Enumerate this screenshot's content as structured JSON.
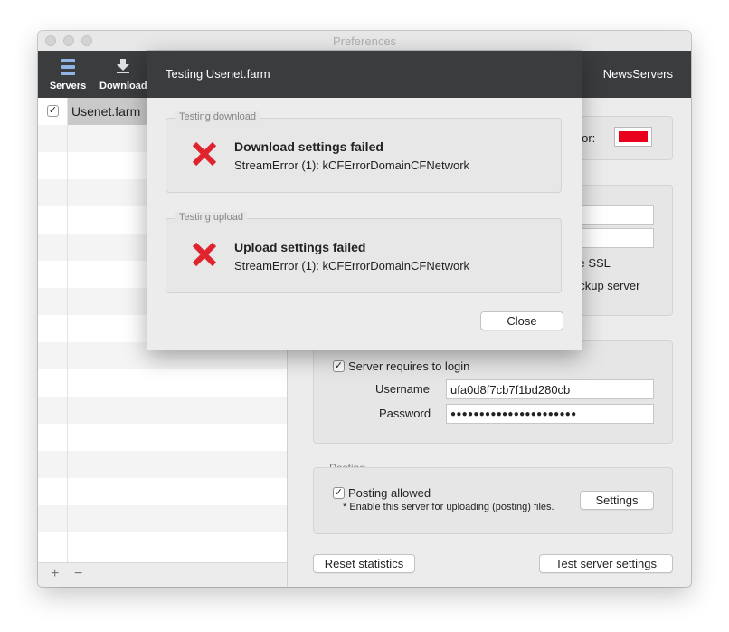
{
  "window": {
    "title": "Preferences"
  },
  "toolbar": {
    "items": [
      {
        "label": "Servers",
        "icon": "servers-icon"
      },
      {
        "label": "Download",
        "icon": "download-icon"
      }
    ],
    "right_label": "NewsServers"
  },
  "sidebar": {
    "servers": [
      {
        "name": "Usenet.farm",
        "checked": true,
        "selected": true
      }
    ],
    "add_label": "+",
    "remove_label": "−"
  },
  "main": {
    "color_label_partial": "olor:",
    "server_color": "#e8001c",
    "ssl_label_partial": "se SSL",
    "backup_label_partial": "ackup server",
    "login": {
      "requires_login_label": "Server requires to login",
      "requires_login_checked": true,
      "username_label": "Username",
      "username_value": "ufa0d8f7cb7f1bd280cb",
      "password_label": "Password",
      "password_value": "●●●●●●●●●●●●●●●●●●●●●●"
    },
    "posting": {
      "legend": "Posting",
      "allowed_label": "Posting allowed",
      "allowed_checked": true,
      "note": "* Enable this server for uploading (posting) files.",
      "settings_button": "Settings"
    },
    "reset_button": "Reset statistics",
    "test_button": "Test server settings"
  },
  "sheet": {
    "title": "Testing Usenet.farm",
    "download_group": {
      "legend": "Testing download",
      "heading": "Download settings failed",
      "message": "StreamError (1): kCFErrorDomainCFNetwork"
    },
    "upload_group": {
      "legend": "Testing upload",
      "heading": "Upload settings failed",
      "message": "StreamError (1): kCFErrorDomainCFNetwork"
    },
    "close_button": "Close",
    "error_color": "#e0242e"
  }
}
